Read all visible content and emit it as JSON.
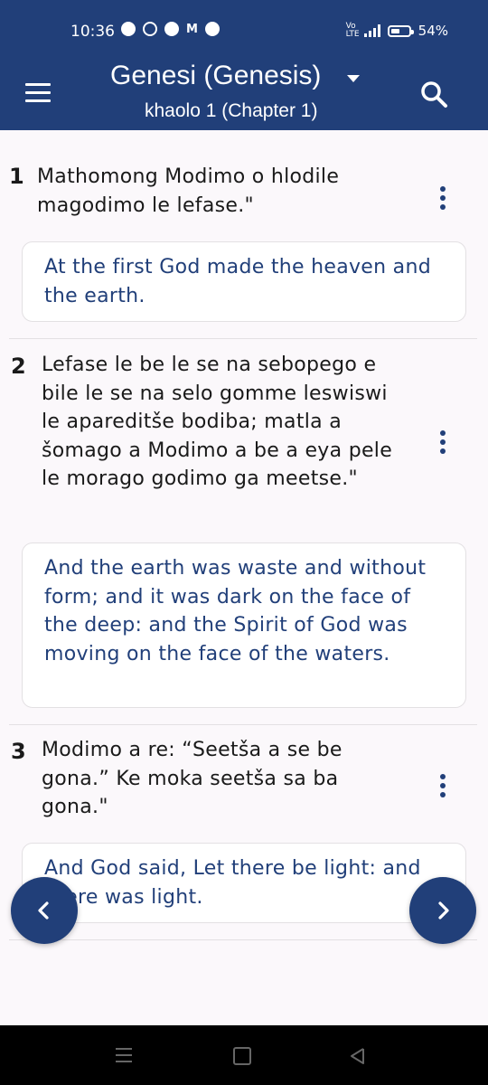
{
  "status": {
    "time": "10:36",
    "battery": "54%",
    "volte": "Vo LTE",
    "battery_fraction": 0.54
  },
  "header": {
    "book": "Genesi (Genesis)",
    "chapter": "khaolo 1 (Chapter 1)"
  },
  "verses": [
    {
      "number": "1",
      "text": "Mathomong Modimo o hlodile magodimo le lefase.\"",
      "translation": "At the first God made the heaven and the earth."
    },
    {
      "number": "2",
      "text": "Lefase le be le se na sebopego e bile le se na selo gomme leswiswi le apareditše bodiba; matla a šomago a Modimo a be a eya pele le morago godimo ga meetse.\"",
      "translation": "And the earth was waste and without form; and it was dark on the face of the deep: and the Spirit of God was moving on the face of the waters."
    },
    {
      "number": "3",
      "text": "Modimo a re: “Seetša a se be gona.” Ke moka seetša sa ba gona.\"",
      "translation": "And God said, Let there be light: and there was light."
    }
  ],
  "icons": {
    "menu": "hamburger-menu-icon",
    "search": "search-icon",
    "more": "more-vert-icon",
    "prev": "chevron-left-icon",
    "next": "chevron-right-icon"
  },
  "colors": {
    "primary": "#213f79",
    "translation_text": "#213f79",
    "background": "#fbf8fb"
  }
}
